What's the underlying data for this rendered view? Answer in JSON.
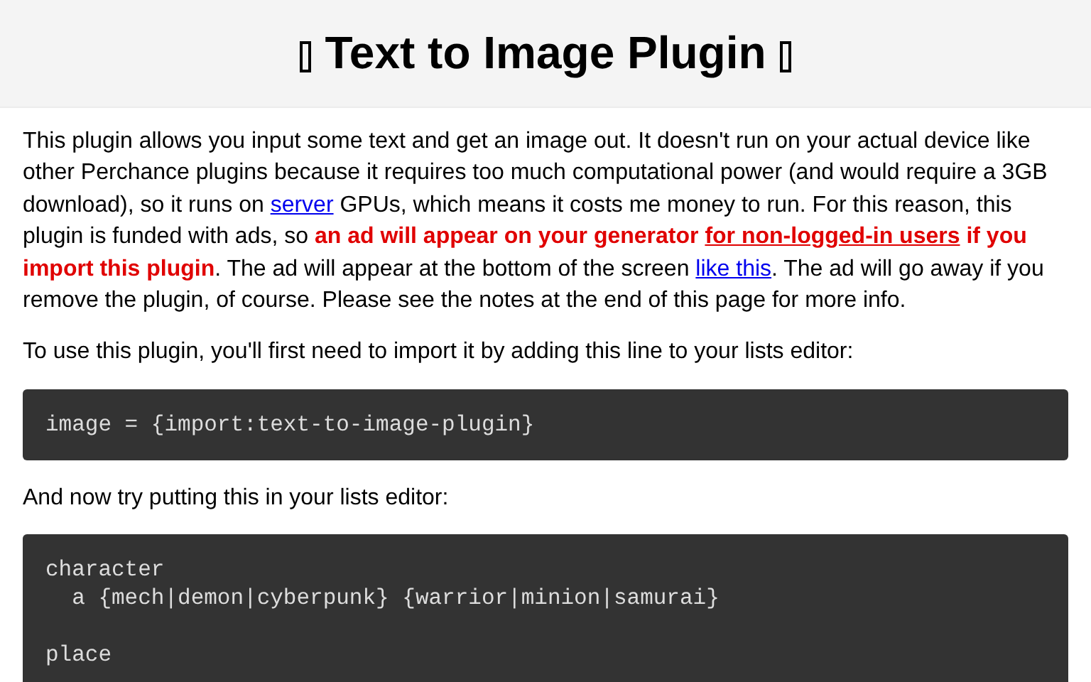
{
  "header": {
    "title": "Text to Image Plugin",
    "missing_glyph_left": true,
    "missing_glyph_right": true
  },
  "intro": [
    {
      "kind": "text",
      "text": "This plugin allows you input some text and get an image out. It doesn't run on your actual device like other Perchance plugins because it requires too much computational power (and would require a 3GB download), so it runs on "
    },
    {
      "kind": "link",
      "text": "server"
    },
    {
      "kind": "text",
      "text": " GPUs, which means it costs me money to run. For this reason, this plugin is funded with ads, so "
    },
    {
      "kind": "alert",
      "text": "an ad will appear on your generator "
    },
    {
      "kind": "alert_link",
      "text": "for non-logged-in users"
    },
    {
      "kind": "alert",
      "text": " if you import this plugin"
    },
    {
      "kind": "text",
      "text": ". The ad will appear at the bottom of the screen "
    },
    {
      "kind": "link",
      "text": "like this"
    },
    {
      "kind": "text",
      "text": ". The ad will go away if you remove the plugin, of course. Please see the notes at the end of this page for more info."
    }
  ],
  "blocks": [
    {
      "kind": "paragraph",
      "text": "To use this plugin, you'll first need to import it by adding this line to your lists editor:"
    },
    {
      "kind": "code",
      "text": "image = {import:text-to-image-plugin}"
    },
    {
      "kind": "paragraph",
      "text": "And now try putting this in your lists editor:"
    },
    {
      "kind": "code",
      "text": "character\n  a {mech|demon|cyberpunk} {warrior|minion|samurai}\n\nplace"
    }
  ]
}
